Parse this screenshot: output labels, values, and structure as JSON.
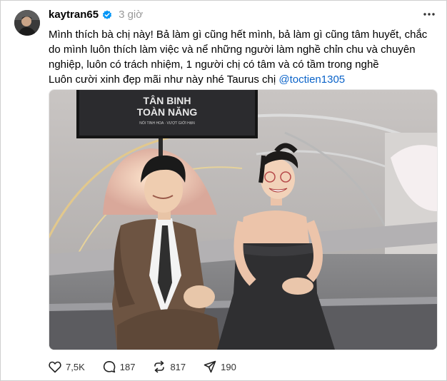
{
  "post": {
    "username": "kaytran65",
    "time": "3 giờ",
    "text_line1": "Mình thích bà chị này! Bả làm gì cũng hết mình, bả làm gì cũng tâm huyết, chắc",
    "text_line2": "do mình luôn thích làm việc và nể những người làm nghề chỉn chu và chuyên",
    "text_line3": "nghiệp, luôn có trách nhiệm, 1 người chị có tâm và có tầm trong nghề",
    "text_line4": "Luôn cười xinh đẹp mãi như này nhé Taurus chị ",
    "mention": "@toctien1305"
  },
  "media": {
    "screen_text_1": "TÂN BINH",
    "screen_text_2": "TOÀN NĂNG",
    "screen_subtext": "NỔI TINH HOA · VƯỢT GIỚI HẠN"
  },
  "actions": {
    "likes": "7,5K",
    "comments": "187",
    "reposts": "817",
    "shares": "190"
  },
  "icons": {
    "verified": "verified-badge-icon",
    "more": "more-dots-icon",
    "like": "heart-icon",
    "comment": "comment-bubble-icon",
    "repost": "repost-arrows-icon",
    "share": "send-icon"
  },
  "colors": {
    "verified": "#0095f6",
    "mention": "#0a63c9",
    "muted": "#999999"
  }
}
